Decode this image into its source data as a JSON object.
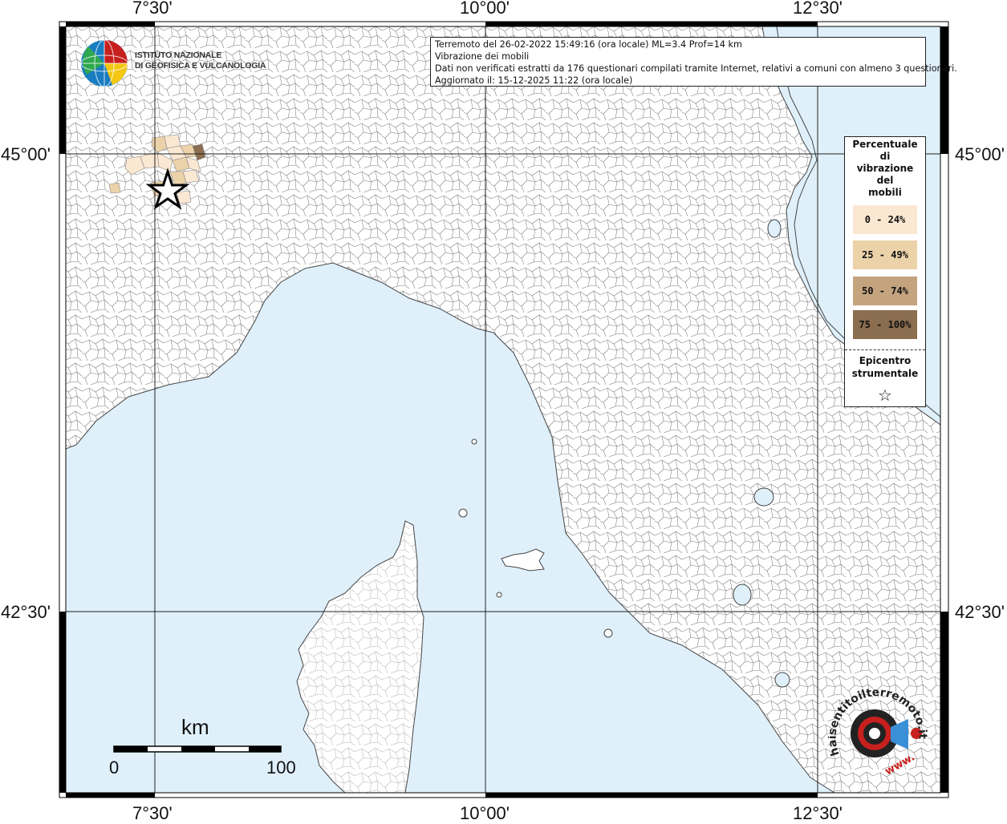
{
  "map": {
    "lon_ticks": [
      "7°30'",
      "10°00'",
      "12°30'"
    ],
    "lat_ticks": [
      "45°00'",
      "42°30'"
    ],
    "colors": {
      "sea": "#dff0fb",
      "land": "#ffffff",
      "border": "#555555",
      "frame": "#000000"
    }
  },
  "info": {
    "line1": "Terremoto del 26-02-2022 15:49:16 (ora locale) ML=3.4 Prof=14 km",
    "line2": "Vibrazione dei mobili",
    "line3": "Dati non verificati estratti da 176 questionari compilati tramite Internet, relativi a comuni con almeno 3 questionari.",
    "line4": "Aggiornato il: 15-12-2025 11:22 (ora locale)"
  },
  "legend": {
    "title_lines": [
      "Percentuale",
      "di",
      "vibrazione",
      "del",
      "mobili"
    ],
    "items": [
      {
        "label": "0 - 24%",
        "color": "#fbe8d2"
      },
      {
        "label": "25 - 49%",
        "color": "#ebd2a9"
      },
      {
        "label": "50 - 74%",
        "color": "#c4a37f"
      },
      {
        "label": "75 - 100%",
        "color": "#8b6d4f"
      }
    ],
    "epicenter_lines": [
      "Epicentro",
      "strumentale"
    ],
    "epicenter_symbol": "☆"
  },
  "logo": {
    "line1": "ISTITUTO NAZIONALE",
    "line2": "DI GEOFISICA E VULCANOLOGIA"
  },
  "scalebar": {
    "unit": "km",
    "min": "0",
    "max": "100"
  },
  "hst_logo": {
    "text": "haisentitoilterremoto.it",
    "www": "www.",
    "icon": "target-speaker-icon"
  }
}
